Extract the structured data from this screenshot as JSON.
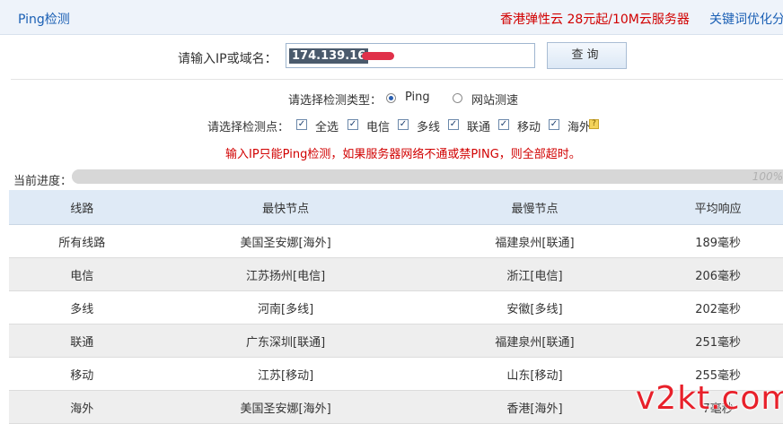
{
  "header": {
    "title": "Ping检测",
    "ad": "香港弹性云 28元起/10M云服务器",
    "keyword_link": "关键词优化分"
  },
  "ip_form": {
    "label": "请输入IP或域名：",
    "value": "174.139.16",
    "button": "查询"
  },
  "check_type": {
    "label": "请选择检测类型：",
    "options": [
      "Ping",
      "网站测速"
    ],
    "selected": "Ping"
  },
  "check_points": {
    "label": "请选择检测点：",
    "options": [
      "全选",
      "电信",
      "多线",
      "联通",
      "移动",
      "海外"
    ],
    "help_icon": "question-icon"
  },
  "notice": "输入IP只能Ping检测，如果服务器网络不通或禁PING，则全部超时。",
  "progress": {
    "label": "当前进度：",
    "percent_text": "100%",
    "value": 1.0
  },
  "table": {
    "headers": [
      "线路",
      "最快节点",
      "最慢节点",
      "平均响应"
    ],
    "rows": [
      [
        "所有线路",
        "美国圣安娜[海外]",
        "福建泉州[联通]",
        "189毫秒"
      ],
      [
        "电信",
        "江苏扬州[电信]",
        "浙江[电信]",
        "206毫秒"
      ],
      [
        "多线",
        "河南[多线]",
        "安徽[多线]",
        "202毫秒"
      ],
      [
        "联通",
        "广东深圳[联通]",
        "福建泉州[联通]",
        "251毫秒"
      ],
      [
        "移动",
        "江苏[移动]",
        "山东[移动]",
        "255毫秒"
      ],
      [
        "海外",
        "美国圣安娜[海外]",
        "香港[海外]",
        "7毫秒"
      ]
    ]
  },
  "watermark": "v2kt.com",
  "colors": {
    "accent_blue": "#1a5fb4",
    "alert_red": "#d10000",
    "header_bg": "#dfeaf6",
    "watermark_red": "#e8202a"
  }
}
